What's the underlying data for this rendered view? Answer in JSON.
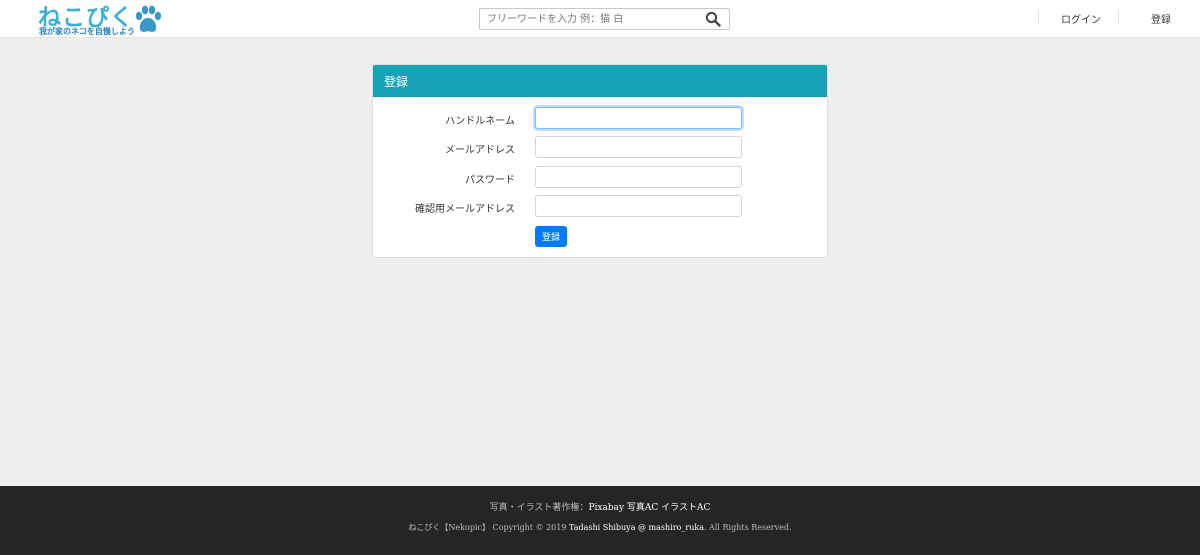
{
  "header": {
    "logo_text": "ねこぴく",
    "logo_tagline": "我が家のネコを自慢しよう",
    "search": {
      "placeholder": "フリーワードを入力 例：猫 白",
      "value": ""
    },
    "nav": {
      "login_label": "ログイン",
      "register_label": "登録"
    }
  },
  "card": {
    "title": "登録",
    "fields": [
      {
        "label": "ハンドルネーム",
        "value": ""
      },
      {
        "label": "メールアドレス",
        "value": ""
      },
      {
        "label": "パスワード",
        "value": ""
      },
      {
        "label": "確認用メールアドレス",
        "value": ""
      }
    ],
    "submit_label": "登録"
  },
  "footer": {
    "credit_prefix": "写真・イラスト著作権：",
    "credit_links": [
      "Pixabay",
      "写真AC",
      "イラストAC"
    ],
    "copyright_prefix": "ねこぴく【Nekopic】 Copyright © 2019 ",
    "author": "Tadashi Shibuya @ mashiro_ruka",
    "copyright_suffix": ". All Rights Reserved."
  },
  "colors": {
    "brand": "#3fb0d3",
    "card_header": "#17a2b8",
    "primary_button": "#007bff",
    "footer_bg": "#252525",
    "page_bg": "#eeeeee"
  },
  "icons": {
    "search": "search-icon",
    "logo_paw": "paw-icon"
  }
}
